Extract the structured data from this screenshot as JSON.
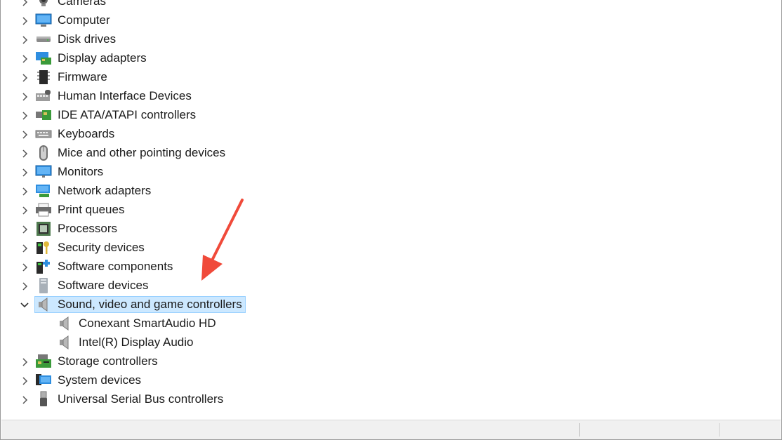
{
  "tree": {
    "items": [
      {
        "label": "Cameras",
        "icon": "camera-icon",
        "expanded": false
      },
      {
        "label": "Computer",
        "icon": "computer-icon",
        "expanded": false
      },
      {
        "label": "Disk drives",
        "icon": "disk-drive-icon",
        "expanded": false
      },
      {
        "label": "Display adapters",
        "icon": "display-adapter-icon",
        "expanded": false
      },
      {
        "label": "Firmware",
        "icon": "firmware-icon",
        "expanded": false
      },
      {
        "label": "Human Interface Devices",
        "icon": "hid-icon",
        "expanded": false
      },
      {
        "label": "IDE ATA/ATAPI controllers",
        "icon": "ide-controller-icon",
        "expanded": false
      },
      {
        "label": "Keyboards",
        "icon": "keyboard-icon",
        "expanded": false
      },
      {
        "label": "Mice and other pointing devices",
        "icon": "mouse-icon",
        "expanded": false
      },
      {
        "label": "Monitors",
        "icon": "monitor-icon",
        "expanded": false
      },
      {
        "label": "Network adapters",
        "icon": "network-adapter-icon",
        "expanded": false
      },
      {
        "label": "Print queues",
        "icon": "printer-icon",
        "expanded": false
      },
      {
        "label": "Processors",
        "icon": "processor-icon",
        "expanded": false
      },
      {
        "label": "Security devices",
        "icon": "security-key-icon",
        "expanded": false
      },
      {
        "label": "Software components",
        "icon": "software-component-icon",
        "expanded": false
      },
      {
        "label": "Software devices",
        "icon": "software-device-icon",
        "expanded": false
      },
      {
        "label": "Sound, video and game controllers",
        "icon": "speaker-icon",
        "expanded": true,
        "selected": true
      },
      {
        "label": "Conexant SmartAudio HD",
        "icon": "speaker-icon",
        "child": true
      },
      {
        "label": "Intel(R) Display Audio",
        "icon": "speaker-icon",
        "child": true
      },
      {
        "label": "Storage controllers",
        "icon": "storage-controller-icon",
        "expanded": false
      },
      {
        "label": "System devices",
        "icon": "system-devices-icon",
        "expanded": false
      },
      {
        "label": "Universal Serial Bus controllers",
        "icon": "usb-icon",
        "expanded": false
      }
    ]
  },
  "colors": {
    "selection_bg": "#cce8ff",
    "selection_border": "#99d1ff",
    "annotation_arrow": "#f04a3a"
  }
}
